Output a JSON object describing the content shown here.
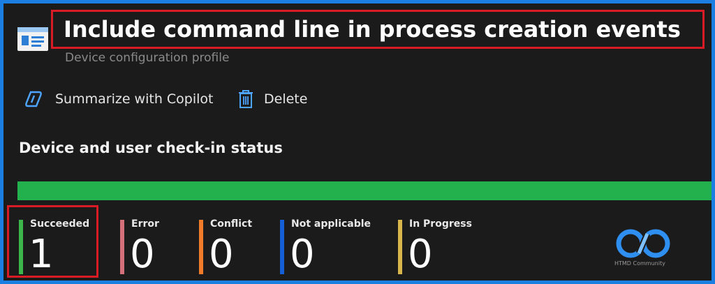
{
  "header": {
    "title": "Include command line in process creation events",
    "subtitle": "Device configuration profile"
  },
  "toolbar": {
    "summarize_label": "Summarize with Copilot",
    "delete_label": "Delete"
  },
  "status": {
    "section_title": "Device and user check-in status",
    "progress": {
      "succeeded_fraction": 1.0,
      "fill_color": "#22b14c"
    },
    "stats": [
      {
        "label": "Succeeded",
        "value": "1",
        "color": "#3cb54a"
      },
      {
        "label": "Error",
        "value": "0",
        "color": "#d4707a"
      },
      {
        "label": "Conflict",
        "value": "0",
        "color": "#f07b2b"
      },
      {
        "label": "Not applicable",
        "value": "0",
        "color": "#1560d6"
      },
      {
        "label": "In Progress",
        "value": "0",
        "color": "#d9b64b"
      }
    ]
  },
  "watermark": {
    "text": "HTMD Community"
  },
  "colors": {
    "highlight": "#d81b25",
    "accent": "#4ea5ff"
  },
  "icons": {
    "profile": "profile-window-icon",
    "copilot": "copilot-icon",
    "delete": "trash-icon"
  }
}
